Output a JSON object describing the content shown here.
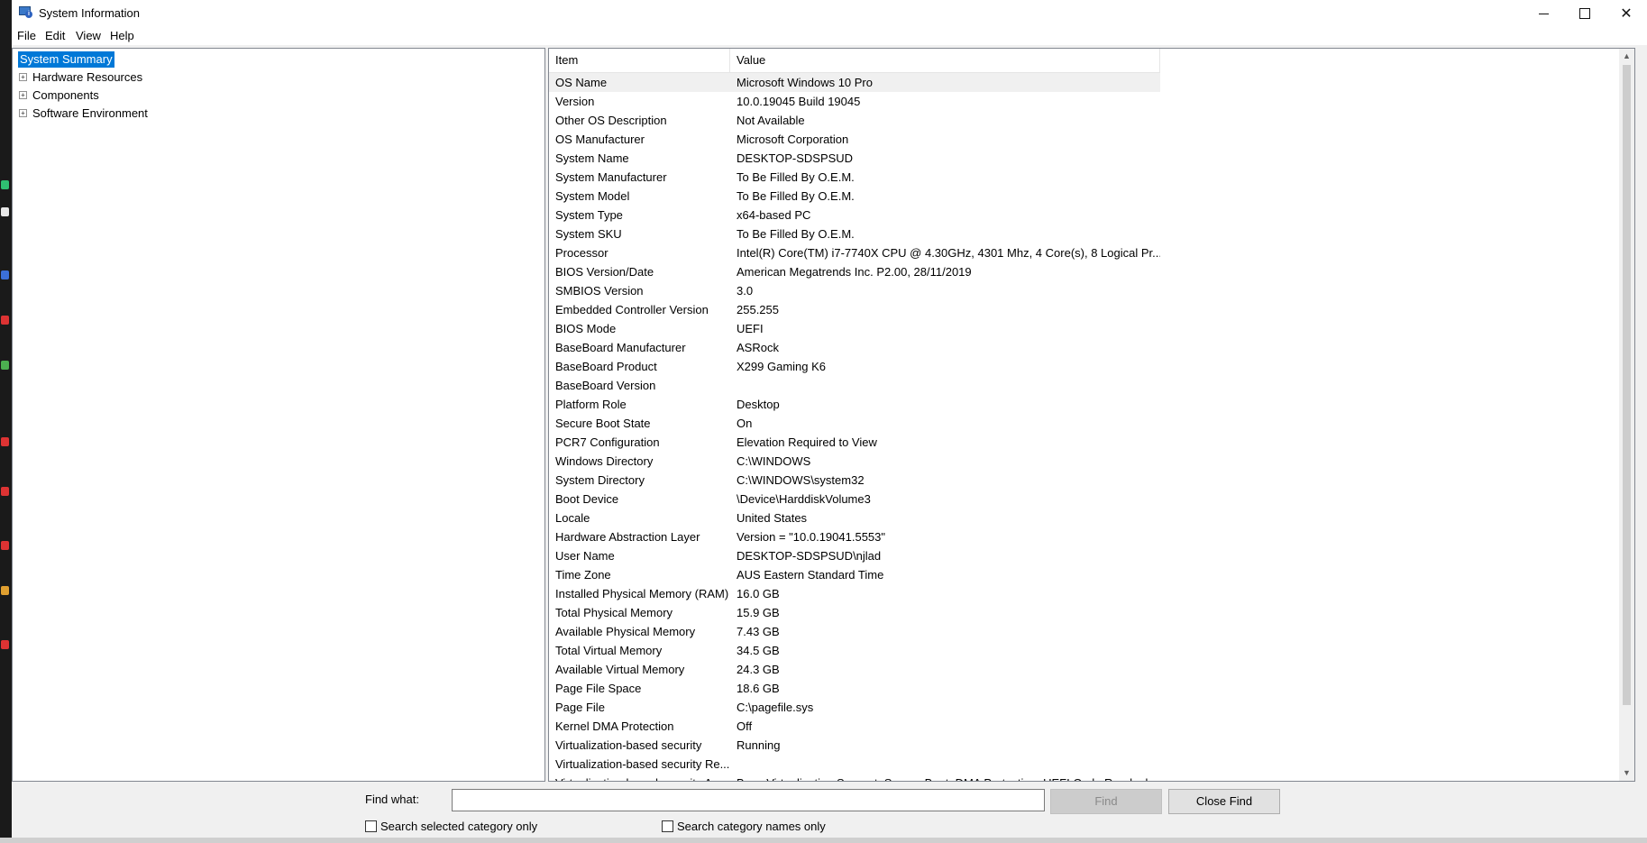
{
  "window": {
    "title": "System Information",
    "minimize_icon": "minimize-icon",
    "maximize_icon": "maximize-icon",
    "close_glyph": "✕"
  },
  "menu": [
    "File",
    "Edit",
    "View",
    "Help"
  ],
  "tree": {
    "root": "System Summary",
    "children": [
      "Hardware Resources",
      "Components",
      "Software Environment"
    ],
    "expander_glyph": "+"
  },
  "list": {
    "columns": {
      "item": "Item",
      "value": "Value"
    },
    "rows": [
      {
        "item": "OS Name",
        "value": "Microsoft Windows 10 Pro"
      },
      {
        "item": "Version",
        "value": "10.0.19045 Build 19045"
      },
      {
        "item": "Other OS Description",
        "value": "Not Available"
      },
      {
        "item": "OS Manufacturer",
        "value": "Microsoft Corporation"
      },
      {
        "item": "System Name",
        "value": "DESKTOP-SDSPSUD"
      },
      {
        "item": "System Manufacturer",
        "value": "To Be Filled By O.E.M."
      },
      {
        "item": "System Model",
        "value": "To Be Filled By O.E.M."
      },
      {
        "item": "System Type",
        "value": "x64-based PC"
      },
      {
        "item": "System SKU",
        "value": "To Be Filled By O.E.M."
      },
      {
        "item": "Processor",
        "value": "Intel(R) Core(TM) i7-7740X CPU @ 4.30GHz, 4301 Mhz, 4 Core(s), 8 Logical Pr..."
      },
      {
        "item": "BIOS Version/Date",
        "value": "American Megatrends Inc. P2.00, 28/11/2019"
      },
      {
        "item": "SMBIOS Version",
        "value": "3.0"
      },
      {
        "item": "Embedded Controller Version",
        "value": "255.255"
      },
      {
        "item": "BIOS Mode",
        "value": "UEFI"
      },
      {
        "item": "BaseBoard Manufacturer",
        "value": "ASRock"
      },
      {
        "item": "BaseBoard Product",
        "value": "X299 Gaming K6"
      },
      {
        "item": "BaseBoard Version",
        "value": ""
      },
      {
        "item": "Platform Role",
        "value": "Desktop"
      },
      {
        "item": "Secure Boot State",
        "value": "On"
      },
      {
        "item": "PCR7 Configuration",
        "value": "Elevation Required to View"
      },
      {
        "item": "Windows Directory",
        "value": "C:\\WINDOWS"
      },
      {
        "item": "System Directory",
        "value": "C:\\WINDOWS\\system32"
      },
      {
        "item": "Boot Device",
        "value": "\\Device\\HarddiskVolume3"
      },
      {
        "item": "Locale",
        "value": "United States"
      },
      {
        "item": "Hardware Abstraction Layer",
        "value": "Version = \"10.0.19041.5553\""
      },
      {
        "item": "User Name",
        "value": "DESKTOP-SDSPSUD\\njlad"
      },
      {
        "item": "Time Zone",
        "value": "AUS Eastern Standard Time"
      },
      {
        "item": "Installed Physical Memory (RAM)",
        "value": "16.0 GB"
      },
      {
        "item": "Total Physical Memory",
        "value": "15.9 GB"
      },
      {
        "item": "Available Physical Memory",
        "value": "7.43 GB"
      },
      {
        "item": "Total Virtual Memory",
        "value": "34.5 GB"
      },
      {
        "item": "Available Virtual Memory",
        "value": "24.3 GB"
      },
      {
        "item": "Page File Space",
        "value": "18.6 GB"
      },
      {
        "item": "Page File",
        "value": "C:\\pagefile.sys"
      },
      {
        "item": "Kernel DMA Protection",
        "value": "Off"
      },
      {
        "item": "Virtualization-based security",
        "value": "Running"
      },
      {
        "item": "Virtualization-based security Re...",
        "value": ""
      },
      {
        "item": "Virtualization-based security Av...",
        "value": "Base Virtualization Support, Secure Boot, DMA Protection, UEFI Code Readonl..."
      }
    ]
  },
  "find": {
    "label": "Find what:",
    "value": "",
    "find_button": "Find",
    "close_button": "Close Find",
    "search_selected": "Search selected category only",
    "search_names": "Search category names only"
  },
  "scroll_arrows": {
    "up": "▲",
    "down": "▼"
  }
}
